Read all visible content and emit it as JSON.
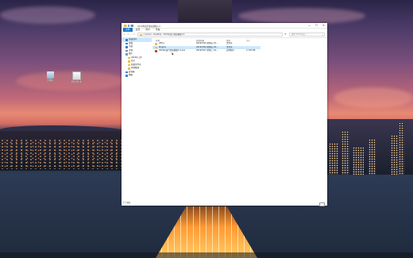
{
  "desktop": {
    "icons": [
      {
        "label": "回收站",
        "icon": "recycle-bin-icon"
      },
      {
        "label": "新建文件夹",
        "icon": "document-icon"
      }
    ]
  },
  "window": {
    "title": "2019年度行事表模版1.0",
    "controls": {
      "minimize": "—",
      "maximize": "☐",
      "close": "✕"
    },
    "ribbon_tabs": [
      "文件",
      "主页",
      "共享",
      "查看"
    ],
    "nav_buttons": {
      "back": "←",
      "forward": "→",
      "recent": "⌄",
      "up": "↑"
    },
    "address": "« Lenovo › Desktop › 2019年度行事表模版1.0",
    "search_placeholder": "搜索\"2019年度...\"",
    "nav_pane": [
      {
        "label": "快速访问",
        "icon": "star-icon",
        "color": "#2f7fd4",
        "sel": true,
        "sub": false
      },
      {
        "label": "桌面",
        "icon": "desktop-icon",
        "color": "#3b83d6",
        "sel": false,
        "sub": false
      },
      {
        "label": "下载",
        "icon": "download-icon",
        "color": "#2f7fd4",
        "sel": false,
        "sub": false
      },
      {
        "label": "文档",
        "icon": "documents-icon",
        "color": "#8a8a8a",
        "sel": false,
        "sub": false
      },
      {
        "label": "图片",
        "icon": "pictures-icon",
        "color": "#5aa0de",
        "sel": false,
        "sub": false
      },
      {
        "label": "2019年工作",
        "icon": "folder-icon",
        "color": "#e9bf4c",
        "sel": false,
        "sub": true
      },
      {
        "label": "日志",
        "icon": "folder-icon",
        "color": "#e9bf4c",
        "sel": false,
        "sub": true
      },
      {
        "label": "新建文件夹",
        "icon": "folder-icon",
        "color": "#e9bf4c",
        "sel": false,
        "sub": true
      },
      {
        "label": "素材整理",
        "icon": "folder-icon",
        "color": "#e9bf4c",
        "sel": false,
        "sub": true
      },
      {
        "label": "此电脑",
        "icon": "pc-icon",
        "color": "#3b83d6",
        "sel": false,
        "sub": false
      },
      {
        "label": "网络",
        "icon": "network-icon",
        "color": "#3b83d6",
        "sel": false,
        "sub": false
      }
    ],
    "columns": {
      "name": "名称",
      "date": "修改日期",
      "type": "类型",
      "size": "大小"
    },
    "files": [
      {
        "name": "office",
        "date": "2019/3/29 星期五 16...",
        "type": "文件夹",
        "size": "",
        "kind": "folder",
        "sel": false
      },
      {
        "name": "Plugins",
        "date": "2019/3/29 星期五 16...",
        "type": "文件夹",
        "size": "",
        "kind": "folder",
        "sel": true
      },
      {
        "name": "2019年度行事表模版1.0.exe",
        "date": "2019/3/27 星期三 16...",
        "type": "应用程序",
        "size": "2,793 KB",
        "kind": "exe",
        "sel": false
      }
    ],
    "status": "3 个项目"
  }
}
